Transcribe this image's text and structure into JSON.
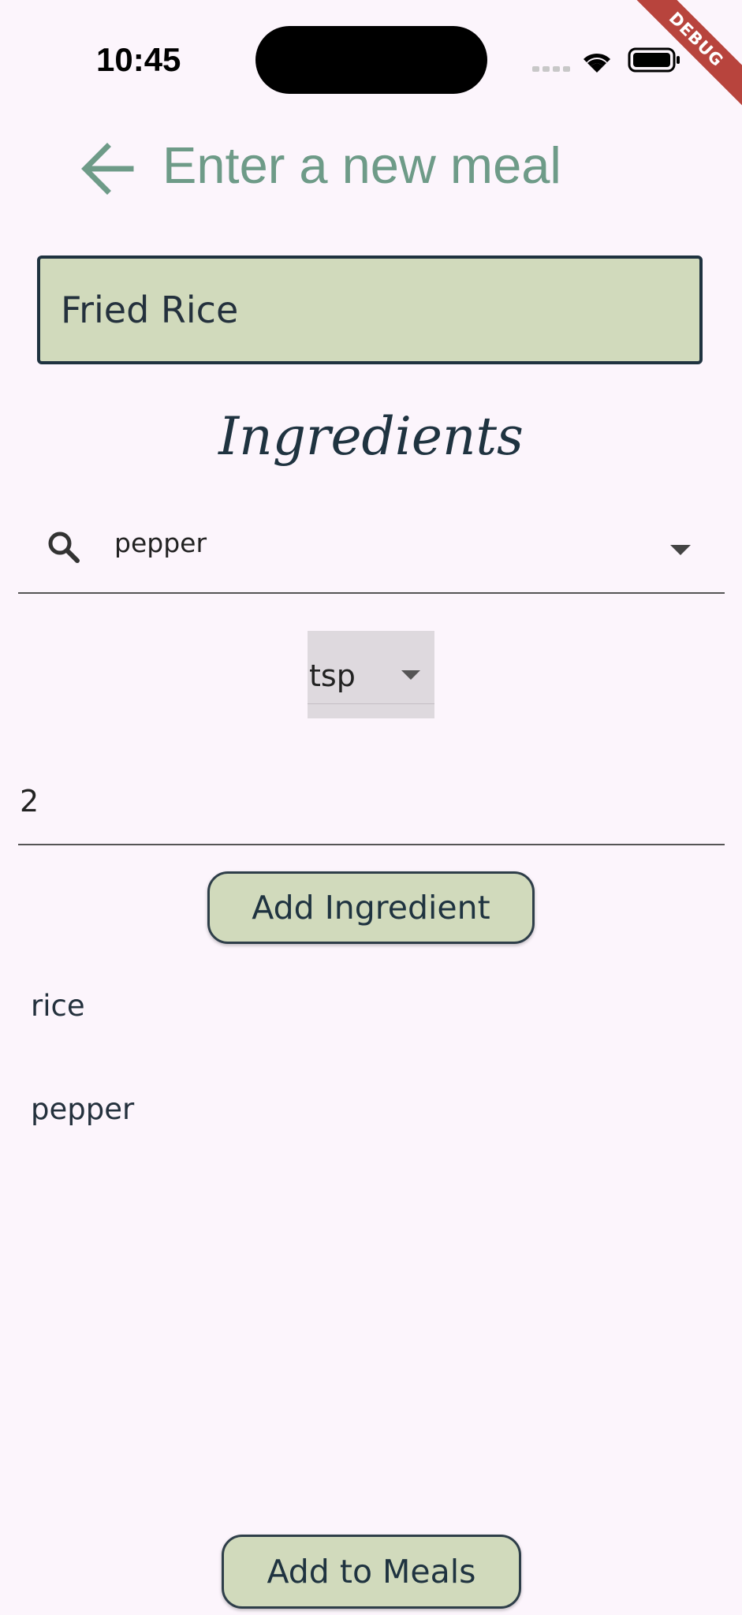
{
  "status_bar": {
    "time": "10:45",
    "debug_label": "DEBUG"
  },
  "app_bar": {
    "title": "Enter a new meal"
  },
  "meal_name": {
    "value": "Fried Rice"
  },
  "ingredients_section": {
    "heading": "Ingredients"
  },
  "ingredient_search": {
    "value": "pepper"
  },
  "unit_select": {
    "value": "tsp"
  },
  "amount_field": {
    "value": "2"
  },
  "buttons": {
    "add_ingredient": "Add Ingredient",
    "add_to_meals": "Add to Meals"
  },
  "ingredients_list": [
    {
      "name": "rice"
    },
    {
      "name": "pepper"
    }
  ],
  "colors": {
    "background": "#fcf5fc",
    "accent_green": "#d1dabc",
    "title_green": "#6e9b88",
    "dark_navy": "#1f3340",
    "debug_red": "#b8443d"
  }
}
